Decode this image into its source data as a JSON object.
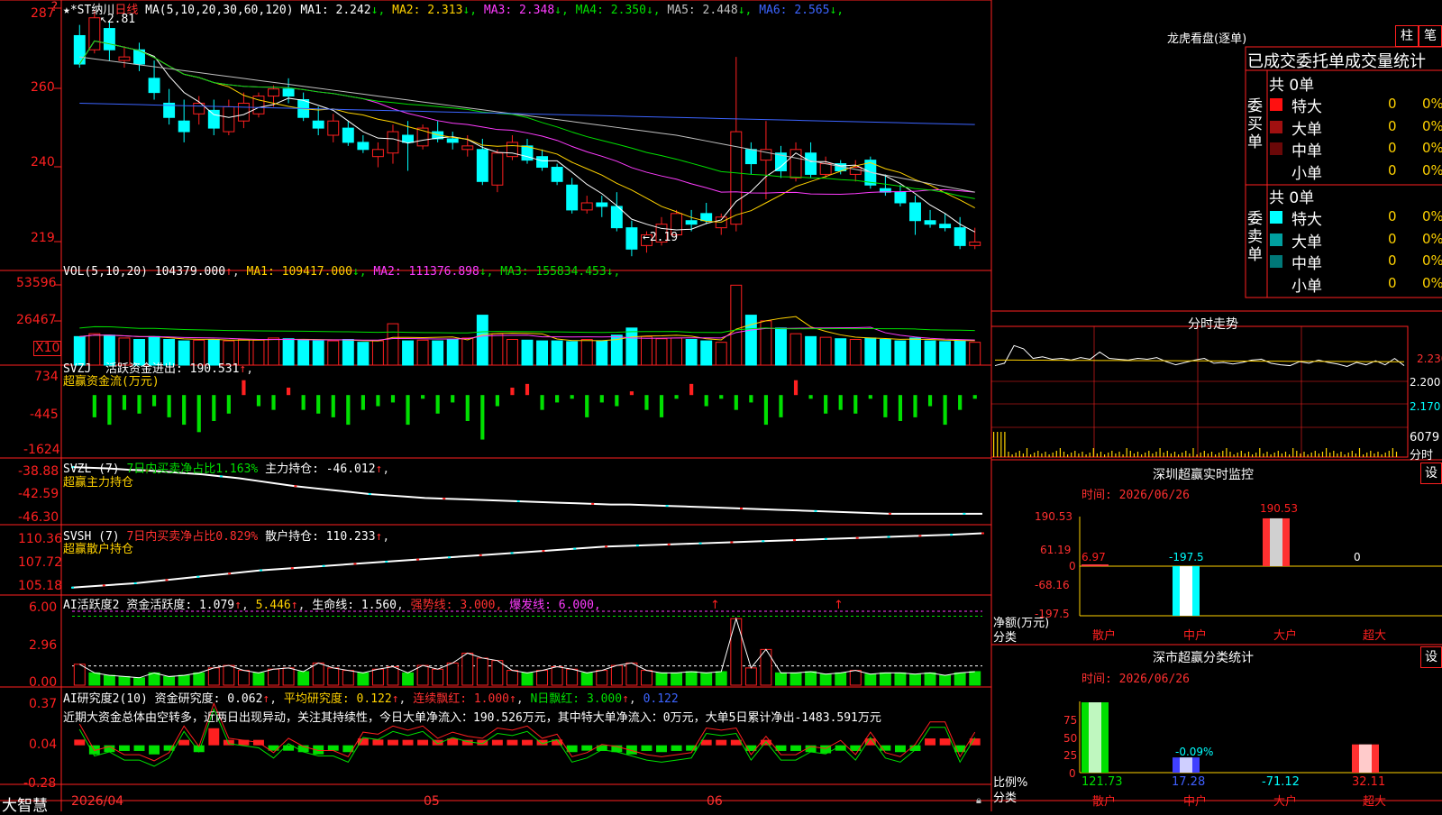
{
  "main": {
    "header": {
      "stars": "★",
      "name": "*ST纳川",
      "period": "日线",
      "ma_head": "MA(5,10,20,30,60,120)",
      "ma": [
        {
          "label": "MA1:",
          "value": "2.242",
          "arrow": "↓",
          "color": "#ffffff"
        },
        {
          "label": "MA2:",
          "value": "2.313",
          "arrow": "↓",
          "color": "#ffd200"
        },
        {
          "label": "MA3:",
          "value": "2.348",
          "arrow": "↓",
          "color": "#ff3cff"
        },
        {
          "label": "MA4:",
          "value": "2.350",
          "arrow": "↓",
          "color": "#00e000"
        },
        {
          "label": "MA5:",
          "value": "2.448",
          "arrow": "↓",
          "color": "#c0c0c0"
        },
        {
          "label": "MA6:",
          "value": "2.565",
          "arrow": "↓",
          "color": "#3c64ff"
        }
      ]
    },
    "high_note": "2.81",
    "low_note": "2.19",
    "y_axis": [
      "287",
      "260",
      "240",
      "219"
    ],
    "corner_mark": "?"
  },
  "vol": {
    "head": "VOL(5,10,20)",
    "value": "104379.000",
    "value_arrow": "↑",
    "ma": [
      {
        "label": "MA1:",
        "value": "109417.000",
        "arrow": "↓",
        "color": "#ffd200"
      },
      {
        "label": "MA2:",
        "value": "111376.898",
        "arrow": "↓",
        "color": "#ff3cff"
      },
      {
        "label": "MA3:",
        "value": "155834.453",
        "arrow": "↓",
        "color": "#00e000"
      }
    ],
    "y_axis": [
      "53596",
      "26467"
    ],
    "unit": "X10"
  },
  "svzj": {
    "head": "SVZJ",
    "label": "活跃资金进出:",
    "value": "190.531",
    "arrow": "↑",
    "subtitle": "超赢资金流(万元)",
    "y_axis": [
      "734",
      "-445",
      "-1624"
    ]
  },
  "svzl": {
    "head": "SVZL (7)",
    "ratio": "7日内买卖净占比1.163%",
    "label": "主力持仓:",
    "value": "-46.012",
    "arrow": "↑",
    "subtitle": "超赢主力持仓",
    "y_axis": [
      "-38.88",
      "-42.59",
      "-46.30"
    ]
  },
  "svsh": {
    "head": "SVSH (7)",
    "ratio": "7日内买卖净占比0.829%",
    "label": "散户持仓:",
    "value": "110.233",
    "arrow": "↑",
    "subtitle": "超赢散户持仓",
    "y_axis": [
      "110.36",
      "107.72",
      "105.18"
    ]
  },
  "ai1": {
    "head": "AI活跃度2",
    "label1": "资金活跃度:",
    "v1": "1.079",
    "v2": "5.446",
    "label2": "生命线:",
    "v3": "1.560",
    "strong": "强势线: 3.000,",
    "burst": "爆发线: 6.000,",
    "y_axis": [
      "6.00",
      "2.96",
      "0.00"
    ]
  },
  "ai2": {
    "head": "AI研究度2(10)",
    "label1": "资金研究度:",
    "v1": "0.062",
    "avg": "平均研究度: 0.122",
    "cont": "连续飘红: 1.000",
    "ndays": "N日飘红: 3.000",
    "last": "0.122",
    "comment": "近期大资金总体由空转多，近两日出现异动，关注其持续性，今日大单净流入：190.526万元，其中特大单净流入：0万元，大单5日累计净出-1483.591万元",
    "y_axis": [
      "0.37",
      "0.04",
      "-0.28"
    ]
  },
  "footer": {
    "brand": "大智慧",
    "date": "2026/04",
    "m5": "05",
    "m6": "06"
  },
  "right": {
    "lhb": {
      "title": "龙虎看盘(逐单)",
      "btn_bar": "柱",
      "btn_tick": "笔",
      "subtitle": "已成交委托单成交量统计",
      "buy_label": "委买单",
      "sell_label": "委卖单",
      "buy_total": "共 0单",
      "sell_total": "共 0单",
      "buy_rows": [
        {
          "name": "特大",
          "count": "0",
          "pct": "0%",
          "color": "#ff1010"
        },
        {
          "name": "大单",
          "count": "0",
          "pct": "0%",
          "color": "#a01010"
        },
        {
          "name": "中单",
          "count": "0",
          "pct": "0%",
          "color": "#6a0808"
        },
        {
          "name": "小单",
          "count": "0",
          "pct": "0%",
          "color": "#000000"
        }
      ],
      "sell_rows": [
        {
          "name": "特大",
          "count": "0",
          "pct": "0%",
          "color": "#00ffff"
        },
        {
          "name": "大单",
          "count": "0",
          "pct": "0%",
          "color": "#00a0a0"
        },
        {
          "name": "中单",
          "count": "0",
          "pct": "0%",
          "color": "#007878"
        },
        {
          "name": "小单",
          "count": "0",
          "pct": "0%",
          "color": "#000000"
        }
      ]
    },
    "intraday": {
      "title": "分时走势",
      "y_axis": [
        "2.230",
        "2.200",
        "2.170"
      ],
      "vol_label": "6079",
      "bottom_label": "分时"
    },
    "monitor": {
      "title": "深圳超赢实时监控",
      "btn": "设",
      "time": "时间: 2026/06/26",
      "y_axis": [
        "190.53",
        "61.19",
        "0",
        "-68.16",
        "-197.5"
      ],
      "ylabel": "净额(万元)",
      "xlabel": "分类",
      "labels": [
        "散户",
        "中户",
        "大户",
        "超大"
      ],
      "value_labels": [
        "6.97",
        "-197.5",
        "190.53",
        "0"
      ]
    },
    "stats": {
      "title": "深市超赢分类统计",
      "btn": "设",
      "time": "时间: 2026/06/26",
      "y_axis": [
        "75",
        "50",
        "25",
        "0"
      ],
      "ylabel": "比例%",
      "xlabel": "分类",
      "labels": [
        "散户",
        "中户",
        "大户",
        "超大"
      ],
      "top_label": "-0.09%",
      "value_labels": [
        "121.73",
        "17.28",
        "-71.12",
        "32.11"
      ]
    }
  },
  "chart_data": [
    {
      "type": "candlestick",
      "title": "*ST纳川 日线",
      "ylim": [
        2.14,
        2.9
      ],
      "high_label": 2.81,
      "low_label": 2.19,
      "ohlc": [
        [
          2.8,
          2.83,
          2.71,
          2.72
        ],
        [
          2.76,
          2.87,
          2.75,
          2.85
        ],
        [
          2.82,
          2.84,
          2.73,
          2.76
        ],
        [
          2.73,
          2.77,
          2.71,
          2.74
        ],
        [
          2.76,
          2.78,
          2.7,
          2.72
        ],
        [
          2.68,
          2.73,
          2.62,
          2.64
        ],
        [
          2.61,
          2.65,
          2.55,
          2.57
        ],
        [
          2.56,
          2.62,
          2.5,
          2.53
        ],
        [
          2.58,
          2.63,
          2.55,
          2.61
        ],
        [
          2.59,
          2.62,
          2.52,
          2.54
        ],
        [
          2.53,
          2.62,
          2.52,
          2.6
        ],
        [
          2.56,
          2.64,
          2.54,
          2.61
        ],
        [
          2.58,
          2.64,
          2.57,
          2.63
        ],
        [
          2.63,
          2.66,
          2.6,
          2.65
        ],
        [
          2.65,
          2.68,
          2.61,
          2.63
        ],
        [
          2.62,
          2.64,
          2.56,
          2.57
        ],
        [
          2.56,
          2.6,
          2.52,
          2.54
        ],
        [
          2.52,
          2.58,
          2.5,
          2.56
        ],
        [
          2.54,
          2.56,
          2.49,
          2.5
        ],
        [
          2.5,
          2.52,
          2.47,
          2.48
        ],
        [
          2.46,
          2.5,
          2.43,
          2.48
        ],
        [
          2.47,
          2.55,
          2.44,
          2.53
        ],
        [
          2.52,
          2.56,
          2.42,
          2.5
        ],
        [
          2.49,
          2.55,
          2.48,
          2.54
        ],
        [
          2.53,
          2.56,
          2.5,
          2.51
        ],
        [
          2.51,
          2.53,
          2.48,
          2.5
        ],
        [
          2.48,
          2.52,
          2.46,
          2.49
        ],
        [
          2.48,
          2.51,
          2.38,
          2.39
        ],
        [
          2.38,
          2.48,
          2.36,
          2.47
        ],
        [
          2.46,
          2.52,
          2.45,
          2.5
        ],
        [
          2.49,
          2.51,
          2.44,
          2.45
        ],
        [
          2.46,
          2.48,
          2.42,
          2.43
        ],
        [
          2.43,
          2.44,
          2.38,
          2.39
        ],
        [
          2.38,
          2.4,
          2.3,
          2.31
        ],
        [
          2.31,
          2.35,
          2.3,
          2.33
        ],
        [
          2.33,
          2.35,
          2.29,
          2.32
        ],
        [
          2.32,
          2.36,
          2.25,
          2.26
        ],
        [
          2.26,
          2.28,
          2.18,
          2.2
        ],
        [
          2.21,
          2.25,
          2.19,
          2.24
        ],
        [
          2.22,
          2.29,
          2.21,
          2.27
        ],
        [
          2.24,
          2.31,
          2.23,
          2.3
        ],
        [
          2.28,
          2.31,
          2.25,
          2.27
        ],
        [
          2.3,
          2.33,
          2.27,
          2.28
        ],
        [
          2.26,
          2.3,
          2.24,
          2.29
        ],
        [
          2.27,
          2.74,
          2.25,
          2.53
        ],
        [
          2.48,
          2.5,
          2.41,
          2.44
        ],
        [
          2.45,
          2.56,
          2.34,
          2.48
        ],
        [
          2.47,
          2.49,
          2.4,
          2.42
        ],
        [
          2.4,
          2.5,
          2.39,
          2.48
        ],
        [
          2.47,
          2.5,
          2.4,
          2.41
        ],
        [
          2.41,
          2.46,
          2.4,
          2.44
        ],
        [
          2.44,
          2.45,
          2.41,
          2.42
        ],
        [
          2.41,
          2.45,
          2.39,
          2.43
        ],
        [
          2.45,
          2.46,
          2.37,
          2.38
        ],
        [
          2.37,
          2.41,
          2.35,
          2.36
        ],
        [
          2.36,
          2.38,
          2.32,
          2.33
        ],
        [
          2.33,
          2.35,
          2.24,
          2.28
        ],
        [
          2.28,
          2.31,
          2.26,
          2.27
        ],
        [
          2.27,
          2.3,
          2.25,
          2.26
        ],
        [
          2.26,
          2.29,
          2.2,
          2.21
        ],
        [
          2.21,
          2.26,
          2.2,
          2.22
        ]
      ]
    },
    {
      "type": "bar",
      "title": "VOL(5,10,20)",
      "ylim": [
        0,
        60000
      ],
      "values": [
        20000,
        22000,
        21000,
        19000,
        18000,
        20000,
        18000,
        17000,
        17500,
        18000,
        17000,
        18000,
        17500,
        19000,
        18500,
        17500,
        17000,
        17000,
        18000,
        16000,
        17000,
        29000,
        17000,
        17500,
        17000,
        18000,
        19000,
        35000,
        22000,
        18000,
        17500,
        17000,
        17000,
        16500,
        18000,
        17000,
        21000,
        26000,
        20000,
        18500,
        19000,
        18000,
        17000,
        16000,
        56000,
        35000,
        31000,
        26000,
        22000,
        20000,
        19500,
        18500,
        18000,
        19000,
        18000,
        17000,
        19000,
        17000,
        16500,
        17000,
        16000
      ]
    },
    {
      "type": "bar",
      "title": "SVZJ 超赢资金流(万元)",
      "ylim": [
        -1624,
        734
      ],
      "values": [
        0,
        -600,
        -800,
        -400,
        -500,
        -300,
        -600,
        -800,
        -1000,
        -700,
        -500,
        400,
        -300,
        -400,
        200,
        -400,
        -500,
        -600,
        -800,
        -400,
        -300,
        -200,
        -800,
        -100,
        -500,
        -200,
        -700,
        -1200,
        -300,
        200,
        300,
        -400,
        -200,
        -100,
        -600,
        -200,
        -300,
        100,
        -400,
        -600,
        -100,
        300,
        -300,
        -100,
        -400,
        -200,
        -800,
        -600,
        400,
        -100,
        -500,
        -400,
        -500,
        -100,
        -600,
        -700,
        -600,
        -300,
        -800,
        -400,
        -100
      ]
    },
    {
      "type": "line",
      "title": "SVZL 超赢主力持仓",
      "ylim": [
        -46.3,
        -38.88
      ],
      "values": [
        -38.9,
        -39.0,
        -39.1,
        -39.3,
        -39.4,
        -39.6,
        -39.8,
        -40.0,
        -40.3,
        -40.6,
        -41.0,
        -41.4,
        -41.8,
        -42.1,
        -42.4,
        -42.7,
        -43.0,
        -43.2,
        -43.4,
        -43.6,
        -43.7,
        -43.8,
        -43.9,
        -44.0,
        -44.1,
        -44.2,
        -44.3,
        -44.4,
        -44.5,
        -44.6,
        -44.6,
        -44.7,
        -44.8,
        -44.9,
        -45.0,
        -45.1,
        -45.2,
        -45.3,
        -45.4,
        -45.5,
        -45.6,
        -45.7,
        -45.8,
        -45.9,
        -46.0,
        -46.0,
        -46.0,
        -46.01,
        -46.01,
        -46.012
      ]
    },
    {
      "type": "line",
      "title": "SVSH 超赢散户持仓",
      "ylim": [
        105.18,
        110.36
      ],
      "values": [
        105.2,
        105.4,
        105.6,
        105.9,
        106.2,
        106.5,
        106.8,
        107.0,
        107.2,
        107.4,
        107.6,
        107.8,
        108.0,
        108.2,
        108.4,
        108.6,
        108.8,
        109.0,
        109.1,
        109.2,
        109.3,
        109.4,
        109.5,
        109.6,
        109.7,
        109.8,
        109.9,
        110.0,
        110.1,
        110.233
      ]
    },
    {
      "type": "bar",
      "title": "AI活跃度2",
      "ylim": [
        0,
        6.0
      ],
      "values": [
        1.7,
        1.0,
        0.8,
        0.7,
        0.6,
        1.0,
        0.7,
        0.8,
        1.0,
        1.4,
        1.6,
        1.2,
        1.0,
        1.3,
        1.4,
        1.1,
        1.8,
        1.4,
        1.2,
        1.0,
        1.3,
        1.5,
        1.0,
        1.6,
        1.3,
        1.8,
        2.6,
        2.2,
        2.0,
        1.2,
        1.0,
        1.2,
        1.5,
        1.3,
        1.0,
        1.2,
        1.6,
        1.8,
        1.2,
        1.0,
        1.0,
        1.1,
        1.0,
        1.1,
        5.4,
        1.4,
        2.9,
        1.0,
        1.0,
        1.1,
        0.9,
        1.0,
        1.2,
        0.9,
        1.0,
        1.0,
        0.9,
        1.0,
        0.8,
        1.0,
        1.1
      ]
    },
    {
      "type": "bar",
      "title": "AI研究度2(10)",
      "ylim": [
        -0.28,
        0.37
      ],
      "values": [
        0.05,
        -0.08,
        -0.06,
        -0.05,
        -0.05,
        -0.08,
        -0.04,
        0.04,
        -0.06,
        0.15,
        0.03,
        0.02,
        0.01,
        -0.04,
        -0.02,
        -0.06,
        -0.08,
        -0.03,
        -0.06,
        0.06,
        0.05,
        0.04,
        0.02,
        0.04,
        0.03,
        0.06,
        0.04,
        0.03,
        0.03,
        0.02,
        0.04,
        0.03,
        0.05,
        -0.06,
        -0.04,
        -0.05,
        -0.06,
        -0.08,
        -0.05,
        -0.06,
        -0.05,
        -0.04,
        0.03,
        0.02,
        0.03,
        -0.05,
        0.04,
        -0.05,
        -0.05,
        -0.06,
        -0.07,
        -0.03,
        -0.05,
        0.06,
        -0.04,
        -0.06,
        -0.05,
        0.06,
        0.06,
        -0.06,
        0.06
      ]
    },
    {
      "type": "line",
      "title": "分时走势",
      "ylim": [
        2.155,
        2.245
      ],
      "values": [
        2.205,
        2.208,
        2.23,
        2.226,
        2.214,
        2.216,
        2.213,
        2.214,
        2.212,
        2.215,
        2.213,
        2.222,
        2.214,
        2.213,
        2.212,
        2.214,
        2.213,
        2.215,
        2.21,
        2.206,
        2.209,
        2.212,
        2.214,
        2.208,
        2.209,
        2.207,
        2.209,
        2.212,
        2.213,
        2.208,
        2.206,
        2.205,
        2.21,
        2.208,
        2.212,
        2.209,
        2.207,
        2.204,
        2.209,
        2.206,
        2.211,
        2.206,
        2.214,
        2.205
      ]
    },
    {
      "type": "bar",
      "title": "深圳超赢实时监控",
      "categories": [
        "散户",
        "中户",
        "大户",
        "超大"
      ],
      "values": [
        6.97,
        -197.5,
        190.53,
        0
      ],
      "ylim": [
        -197.5,
        190.53
      ]
    },
    {
      "type": "bar",
      "title": "深市超赢分类统计",
      "categories": [
        "散户",
        "中户",
        "大户",
        "超大"
      ],
      "values": [
        121.73,
        17.28,
        -71.12,
        32.11
      ],
      "ylim": [
        0,
        75
      ]
    }
  ]
}
